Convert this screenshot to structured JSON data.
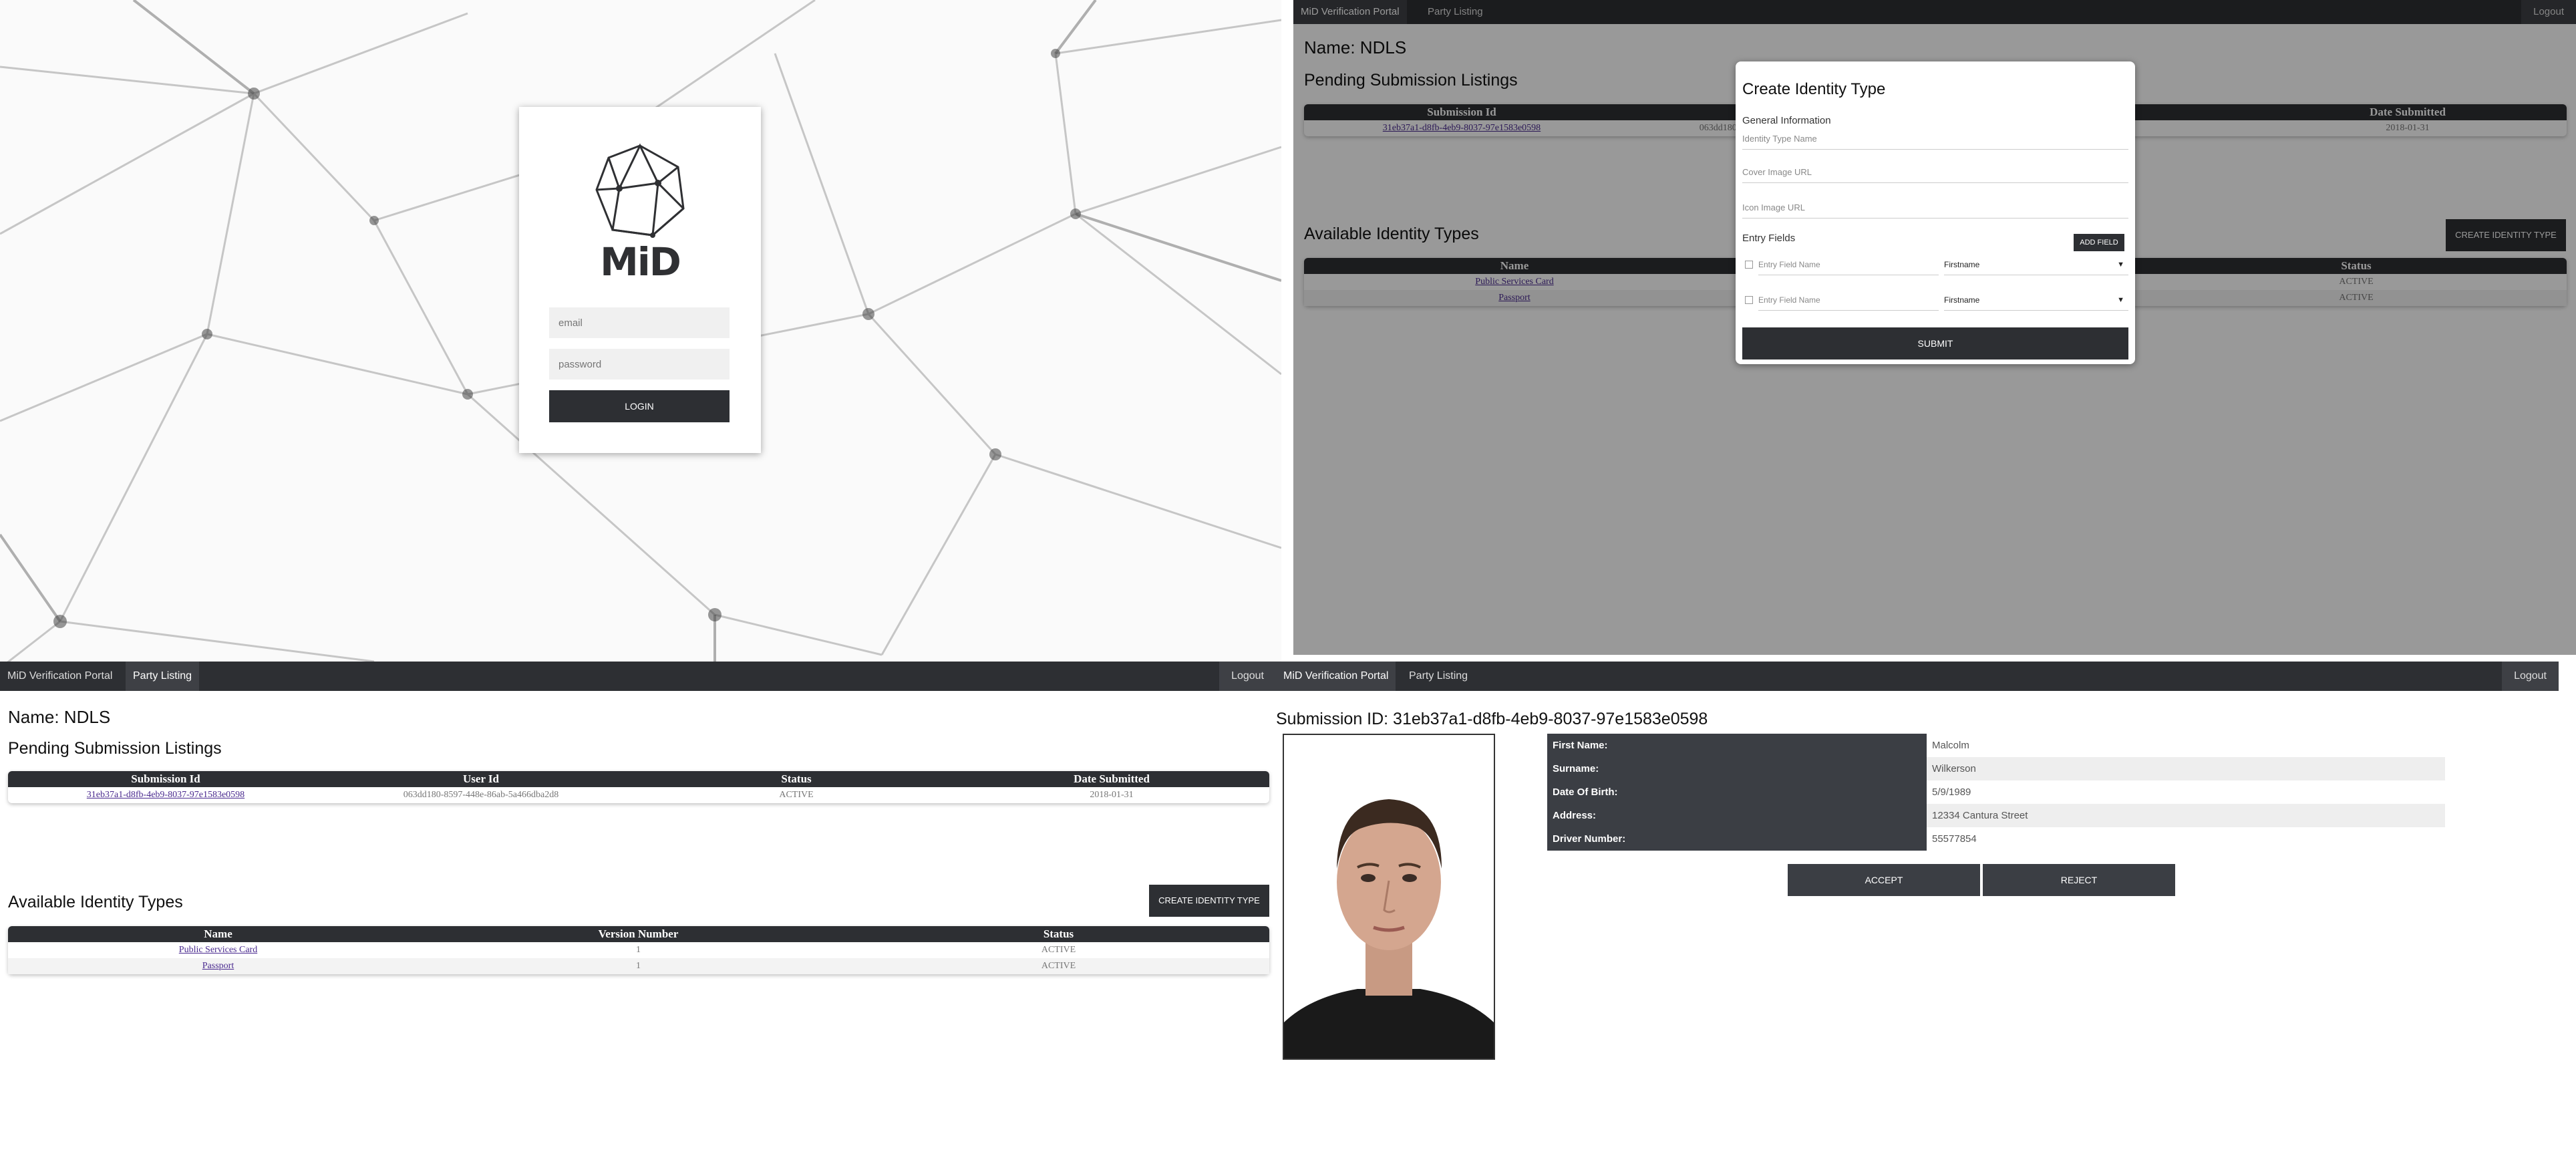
{
  "login": {
    "logo_text": "MiD",
    "email_placeholder": "email",
    "password_placeholder": "password",
    "login_label": "LOGIN"
  },
  "nav": {
    "brand": "MiD Verification Portal",
    "party_listing": "Party Listing",
    "logout": "Logout"
  },
  "dashboard": {
    "name_label": "Name: NDLS",
    "pending_heading": "Pending Submission Listings",
    "pending_columns": [
      "Submission Id",
      "User Id",
      "Status",
      "Date Submitted"
    ],
    "pending_rows": [
      {
        "submission_id": "31eb37a1-d8fb-4eb9-8037-97e1583e0598",
        "user_id": "063dd180-8597-448e-86ab-5a466dba2d8",
        "status": "ACTIVE",
        "date": "2018-01-31"
      }
    ],
    "types_heading": "Available Identity Types",
    "create_label": "CREATE IDENTITY TYPE",
    "types_columns": [
      "Name",
      "Version Number",
      "Status"
    ],
    "types_rows": [
      {
        "name": "Public Services Card",
        "version": "1",
        "status": "ACTIVE"
      },
      {
        "name": "Passport",
        "version": "1",
        "status": "ACTIVE"
      }
    ]
  },
  "modal": {
    "title": "Create Identity Type",
    "general_info": "General Information",
    "identity_type_name": "Identity Type Name",
    "cover_image_url": "Cover Image URL",
    "icon_image_url": "Icon Image URL",
    "entry_fields": "Entry Fields",
    "add_field": "ADD FIELD",
    "entries": [
      {
        "placeholder": "Entry Field Name",
        "type": "Firstname"
      },
      {
        "placeholder": "Entry Field Name",
        "type": "Firstname"
      }
    ],
    "submit": "SUBMIT"
  },
  "detail": {
    "title": "Submission ID: 31eb37a1-d8fb-4eb9-8037-97e1583e0598",
    "fields": [
      {
        "label": "First Name:",
        "value": "Malcolm"
      },
      {
        "label": "Surname:",
        "value": "Wilkerson"
      },
      {
        "label": "Date Of Birth:",
        "value": "5/9/1989"
      },
      {
        "label": "Address:",
        "value": "12334 Cantura Street"
      },
      {
        "label": "Driver Number:",
        "value": "55577854"
      }
    ],
    "accept": "ACCEPT",
    "reject": "REJECT"
  },
  "colors": {
    "dark": "#2d2f33",
    "link": "#4a2a8f"
  }
}
